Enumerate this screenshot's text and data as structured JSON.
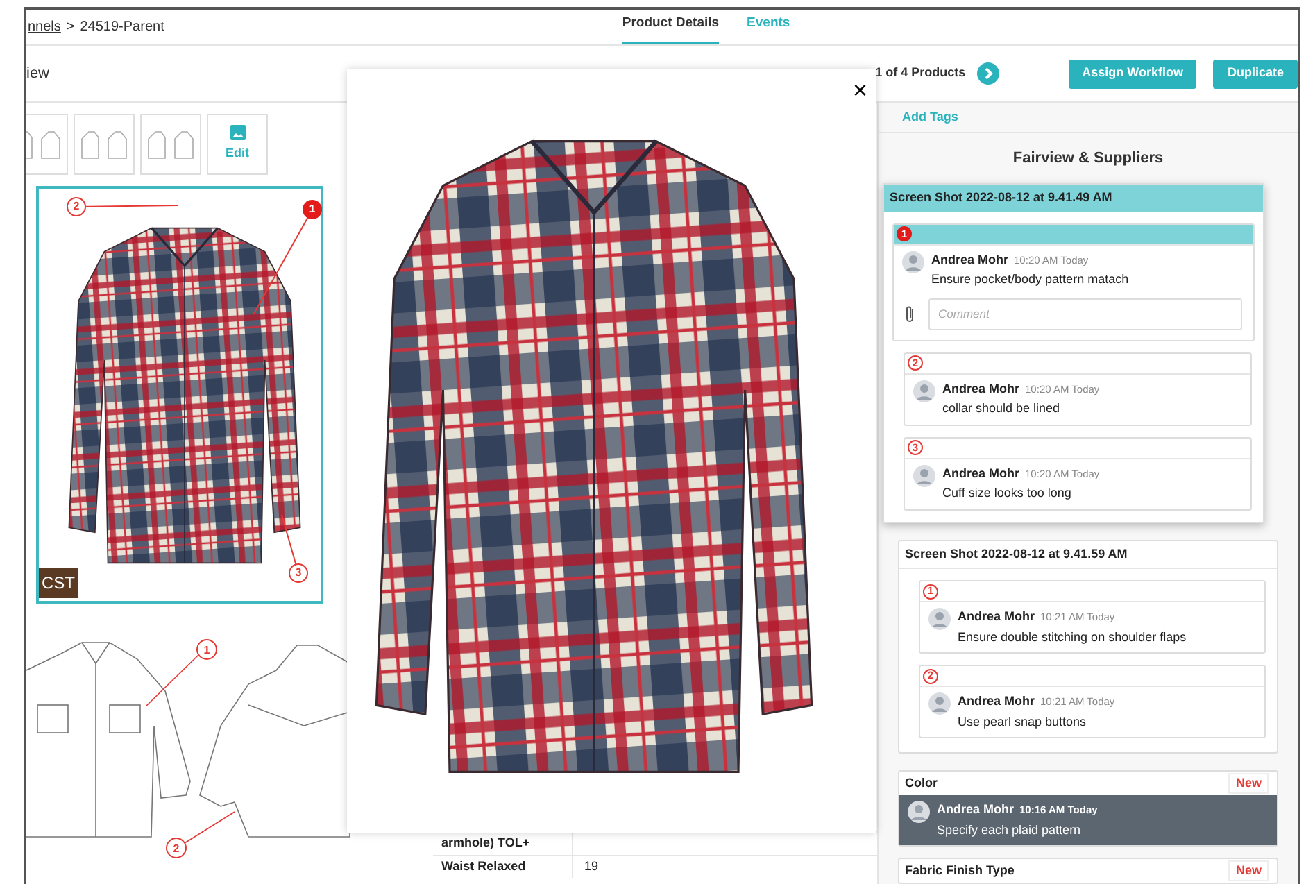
{
  "breadcrumb": {
    "link": "nnels",
    "separator": ">",
    "current": "24519-Parent"
  },
  "tabs": [
    {
      "label": "Product Details",
      "selected": true
    },
    {
      "label": "Events",
      "selected": false
    }
  ],
  "section_title": "iew",
  "pager": {
    "text": "1 of 4 Products"
  },
  "buttons": [
    "Assign Workflow",
    "Duplicate"
  ],
  "thumbnails": {
    "edit_label": "Edit"
  },
  "photo": {
    "tag": "CST",
    "markers": [
      {
        "number": "1",
        "filled": true
      },
      {
        "number": "2",
        "filled": false
      },
      {
        "number": "3",
        "filled": false
      }
    ]
  },
  "sketch": {
    "markers": [
      {
        "number": "1"
      },
      {
        "number": "2"
      }
    ]
  },
  "modal": {
    "close": "×"
  },
  "details_table": {
    "rows": [
      {
        "label": "armhole) TOL+"
      },
      {
        "label": "Waist Relaxed",
        "value": "19"
      }
    ]
  },
  "side_panel": {
    "add_tags": "Add Tags",
    "title": "Fairview & Suppliers",
    "threads": [
      {
        "title": "Screen Shot 2022-08-12 at 9.41.49 AM",
        "selected": true,
        "annotations": [
          {
            "number": "1",
            "selected": true,
            "author": "Andrea Mohr",
            "time": "10:20 AM Today",
            "text": "Ensure pocket/body pattern matach",
            "comment_placeholder": "Comment"
          },
          {
            "number": "2",
            "selected": false,
            "author": "Andrea Mohr",
            "time": "10:20 AM Today",
            "text": "collar should be lined"
          },
          {
            "number": "3",
            "selected": false,
            "author": "Andrea Mohr",
            "time": "10:20 AM Today",
            "text": "Cuff size looks too long"
          }
        ]
      },
      {
        "title": "Screen Shot 2022-08-12 at 9.41.59 AM",
        "selected": false,
        "annotations": [
          {
            "number": "1",
            "selected": false,
            "author": "Andrea Mohr",
            "time": "10:21 AM Today",
            "text": "Ensure double stitching on shoulder flaps"
          },
          {
            "number": "2",
            "selected": false,
            "author": "Andrea Mohr",
            "time": "10:21 AM Today",
            "text": "Use pearl snap buttons"
          }
        ]
      }
    ],
    "notes": [
      {
        "title": "Color",
        "badge": "New",
        "author": "Andrea Mohr",
        "time": "10:16 AM Today",
        "text": "Specify each plaid pattern"
      },
      {
        "title": "Fabric Finish Type",
        "badge": "New"
      }
    ]
  }
}
